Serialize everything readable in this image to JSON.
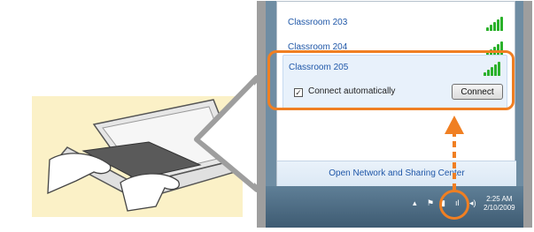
{
  "networks": [
    {
      "name": "Classroom 203"
    },
    {
      "name": "Classroom 204"
    }
  ],
  "selected_network": {
    "name": "Classroom 205",
    "auto_connect_label": "Connect automatically",
    "auto_connect_checked": true,
    "connect_button": "Connect"
  },
  "footer": {
    "link": "Open Network and Sharing Center"
  },
  "taskbar": {
    "time": "2:25 AM",
    "date": "2/10/2009"
  },
  "colors": {
    "accent": "#f07f22",
    "link": "#1f57a8",
    "signal": "#2bb12b"
  },
  "icons": [
    "laptop-illustration",
    "signal-bars-icon",
    "network-tray-icon",
    "flag-icon",
    "volume-icon",
    "show-hidden-icons-icon"
  ]
}
